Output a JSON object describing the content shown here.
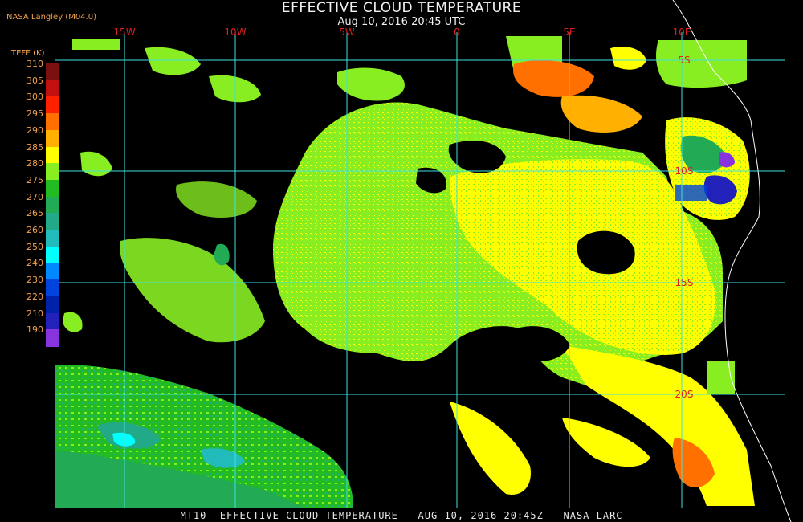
{
  "header": {
    "title": "EFFECTIVE CLOUD TEMPERATURE",
    "subtitle": "Aug 10, 2016 20:45 UTC",
    "source": "NASA Langley (M04.0)"
  },
  "legend": {
    "title": "TEFF (K)",
    "items": [
      {
        "label": "310",
        "color": "#7a1010"
      },
      {
        "label": "305",
        "color": "#c01010"
      },
      {
        "label": "300",
        "color": "#ff2000"
      },
      {
        "label": "295",
        "color": "#ff7000"
      },
      {
        "label": "290",
        "color": "#ffb000"
      },
      {
        "label": "285",
        "color": "#ffff00"
      },
      {
        "label": "280",
        "color": "#88ee22"
      },
      {
        "label": "275",
        "color": "#22bb22"
      },
      {
        "label": "270",
        "color": "#22aa55"
      },
      {
        "label": "265",
        "color": "#22aa88"
      },
      {
        "label": "260",
        "color": "#22bbbb"
      },
      {
        "label": "250",
        "color": "#00ffff"
      },
      {
        "label": "240",
        "color": "#0088ff"
      },
      {
        "label": "230",
        "color": "#0044dd"
      },
      {
        "label": "220",
        "color": "#0022aa"
      },
      {
        "label": "210",
        "color": "#2222bb"
      },
      {
        "label": "190",
        "color": "#8833dd"
      }
    ]
  },
  "map": {
    "grid_color": "#40e0e0",
    "longitude_labels": [
      "15W",
      "10W",
      "5W",
      "0",
      "5E",
      "10E"
    ],
    "latitude_labels": [
      "5S",
      "10S",
      "15S",
      "20S"
    ]
  },
  "footer": {
    "text": "MT10  EFFECTIVE CLOUD TEMPERATURE   AUG 10, 2016 20:45Z   NASA LARC"
  }
}
